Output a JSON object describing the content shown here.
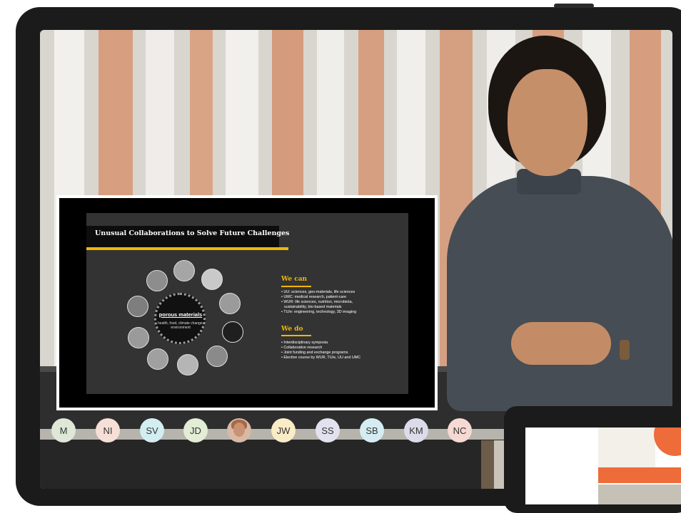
{
  "slide": {
    "title": "Unusual Collaborations to Solve Future Challenges",
    "center_title": "porous materials",
    "center_subtitle": "health, food, climate change, environment",
    "we_can_heading": "We can",
    "we_can_items": [
      "• UU: sciences, geo-materials, life sciences",
      "• UMC: medical research, patient-care",
      "• WUR: life sciences, nutrition, microbiota,",
      "  sustainability, bio-based materials",
      "• TU/e: engineering, technology, 3D imaging"
    ],
    "we_do_heading": "We do",
    "we_do_items": [
      "• Interdisciplinary symposia",
      "• Collaborative research",
      "• Joint funding and exchange programs",
      "• Elective course by WUR, TU/e, UU and UMC"
    ]
  },
  "participants": [
    {
      "initials": "M",
      "color": "#dfe7d9"
    },
    {
      "initials": "NI",
      "color": "#f6dfd6"
    },
    {
      "initials": "SV",
      "color": "#d2eef1"
    },
    {
      "initials": "JD",
      "color": "#e3ecd4"
    },
    {
      "initials": "",
      "color": "#d8b9a6",
      "photo": true
    },
    {
      "initials": "JW",
      "color": "#f9ecc6"
    },
    {
      "initials": "SS",
      "color": "#e2e1ef"
    },
    {
      "initials": "SB",
      "color": "#d5edf2"
    },
    {
      "initials": "KM",
      "color": "#dcdbea"
    },
    {
      "initials": "NC",
      "color": "#f6d9d3"
    }
  ]
}
